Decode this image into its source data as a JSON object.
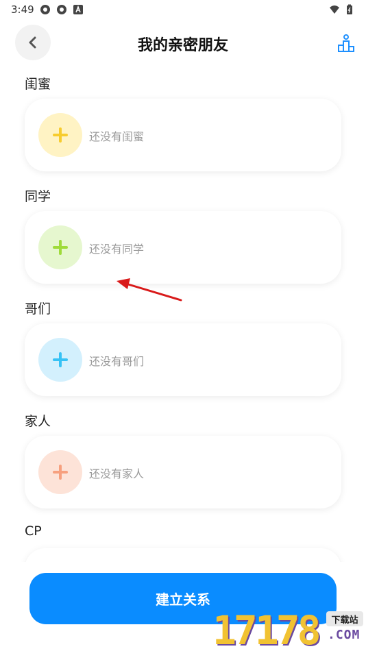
{
  "status_bar": {
    "time": "3:49",
    "left_icons": [
      "settings-icon",
      "settings-icon",
      "notification-a-icon"
    ],
    "right_icons": [
      "wifi-icon",
      "battery-icon"
    ]
  },
  "header": {
    "back_icon": "chevron-left-icon",
    "title": "我的亲密朋友",
    "ranking_icon": "ranking-podium-icon",
    "accent_color": "#1e90ff"
  },
  "sections": [
    {
      "label": "闺蜜",
      "empty_text": "还没有闺蜜",
      "circle_color": "#fff3c4",
      "plus_color": "#f7cc2e"
    },
    {
      "label": "同学",
      "empty_text": "还没有同学",
      "circle_color": "#e6f7cf",
      "plus_color": "#9fdb3a"
    },
    {
      "label": "哥们",
      "empty_text": "还没有哥们",
      "circle_color": "#d3f0fd",
      "plus_color": "#37c2f5"
    },
    {
      "label": "家人",
      "empty_text": "还没有家人",
      "circle_color": "#fde3d8",
      "plus_color": "#f7a07e"
    },
    {
      "label": "CP",
      "empty_text": "",
      "circle_color": "#fde0ea",
      "plus_color": "#f78aa8"
    }
  ],
  "primary_button": {
    "label": "建立关系",
    "color": "#0a8cff"
  },
  "watermark": {
    "number": "17178",
    "badge": "下载站",
    "domain": ".COM"
  }
}
